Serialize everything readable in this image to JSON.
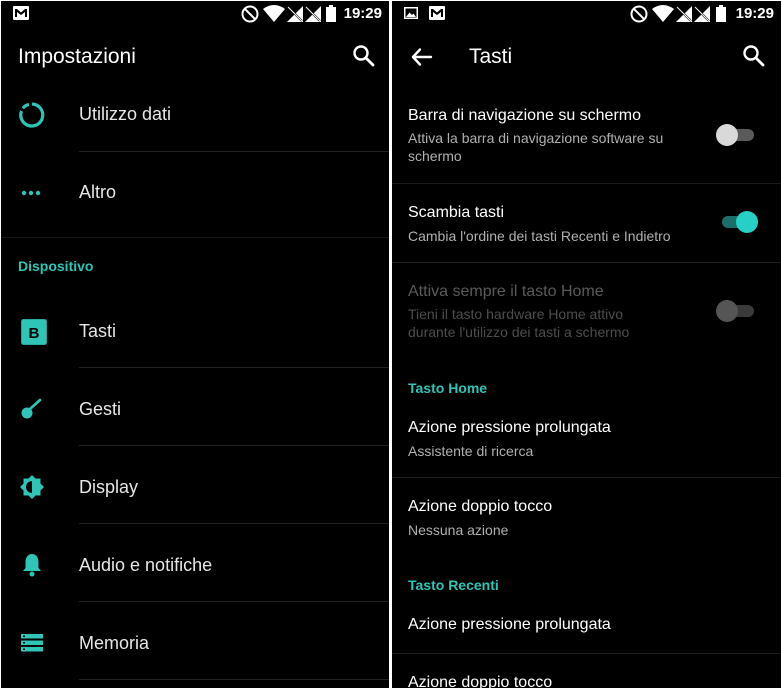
{
  "status": {
    "time": "19:29"
  },
  "left": {
    "title": "Impostazioni",
    "items": [
      {
        "label": "Utilizzo dati",
        "icon": "data-usage-icon"
      },
      {
        "label": "Altro",
        "icon": "more-icon"
      }
    ],
    "section": "Dispositivo",
    "device_items": [
      {
        "label": "Tasti",
        "icon": "buttons-icon"
      },
      {
        "label": "Gesti",
        "icon": "gestures-icon"
      },
      {
        "label": "Display",
        "icon": "display-icon"
      },
      {
        "label": "Audio e notifiche",
        "icon": "bell-icon"
      },
      {
        "label": "Memoria",
        "icon": "storage-icon"
      }
    ]
  },
  "right": {
    "title": "Tasti",
    "prefs": [
      {
        "title": "Barra di navigazione su schermo",
        "summary_1": "Attiva la barra di navigazione software su",
        "summary_2": "schermo",
        "switch": "off"
      },
      {
        "title": "Scambia tasti",
        "summary_1": "Cambia l'ordine dei tasti Recenti e Indietro",
        "switch": "on"
      },
      {
        "title": "Attiva sempre il tasto Home",
        "summary_1": "Tieni il tasto hardware Home attivo",
        "summary_2": "durante l'utilizzo dei tasti a schermo",
        "switch": "disabled"
      }
    ],
    "section_home": "Tasto Home",
    "home_prefs": [
      {
        "title": "Azione pressione prolungata",
        "summary": "Assistente di ricerca"
      },
      {
        "title": "Azione doppio tocco",
        "summary": "Nessuna azione"
      }
    ],
    "section_recent": "Tasto Recenti",
    "recent_prefs": [
      {
        "title": "Azione pressione prolungata"
      },
      {
        "title": "Azione doppio tocco"
      }
    ]
  },
  "colors": {
    "accent": "#2ec4b6",
    "background": "#000000"
  }
}
